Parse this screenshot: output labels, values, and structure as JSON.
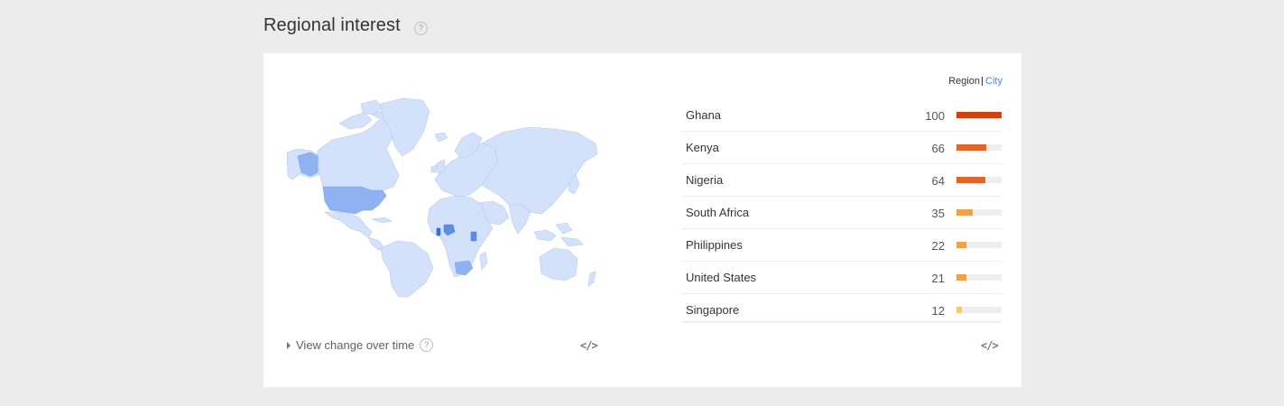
{
  "section": {
    "title": "Regional interest",
    "help": "?"
  },
  "toggle": {
    "region": "Region",
    "city": "City"
  },
  "map": {
    "link_color": "#4285f4",
    "highlighted_countries": [
      "United States",
      "Ghana",
      "Nigeria",
      "Kenya",
      "South Africa"
    ]
  },
  "rows": [
    {
      "name": "Ghana",
      "value": "100",
      "pct": 100,
      "color": "#d14210"
    },
    {
      "name": "Kenya",
      "value": "66",
      "pct": 66,
      "color": "#e0662a"
    },
    {
      "name": "Nigeria",
      "value": "64",
      "pct": 64,
      "color": "#e0662a"
    },
    {
      "name": "South Africa",
      "value": "35",
      "pct": 35,
      "color": "#eea24e"
    },
    {
      "name": "Philippines",
      "value": "22",
      "pct": 22,
      "color": "#eea24e"
    },
    {
      "name": "United States",
      "value": "21",
      "pct": 21,
      "color": "#eea24e"
    },
    {
      "name": "Singapore",
      "value": "12",
      "pct": 12,
      "color": "#f7c96a"
    }
  ],
  "footer": {
    "view_change": "View change over time",
    "help": "?",
    "embed": "</>",
    "icons": [
      "caret-right-icon",
      "help-icon",
      "embed-code-icon"
    ]
  }
}
